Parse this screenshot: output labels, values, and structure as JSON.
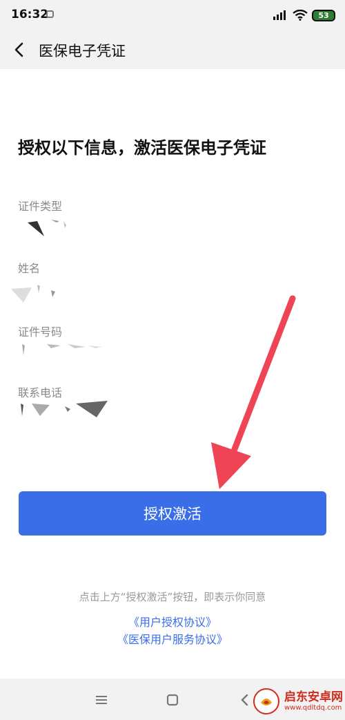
{
  "status_bar": {
    "time": "16:32",
    "battery": "53"
  },
  "app_bar": {
    "title": "医保电子凭证",
    "back_icon": "chevron-left-icon"
  },
  "headline": "授权以下信息，激活医保电子凭证",
  "fields": [
    {
      "label": "证件类型"
    },
    {
      "label": "姓名"
    },
    {
      "label": "证件号码"
    },
    {
      "label": "联系电话"
    }
  ],
  "authorize_button": {
    "label": "授权激活",
    "color": "#3a6ee8"
  },
  "notice": "点击上方“授权激活”按钮，即表示你同意",
  "links": {
    "user_agreement": "《用户授权协议》",
    "service_agreement": "《医保用户服务协议》"
  },
  "nav_bar": {
    "menu_icon": "menu-icon",
    "home_icon": "square-home-icon",
    "back_icon": "back-triangle-icon"
  },
  "watermark": {
    "title": "启东安卓网",
    "url": "www.qdltdq.com",
    "accent": "#d12b1e"
  },
  "annotation": {
    "arrow_color": "#ee4455"
  }
}
